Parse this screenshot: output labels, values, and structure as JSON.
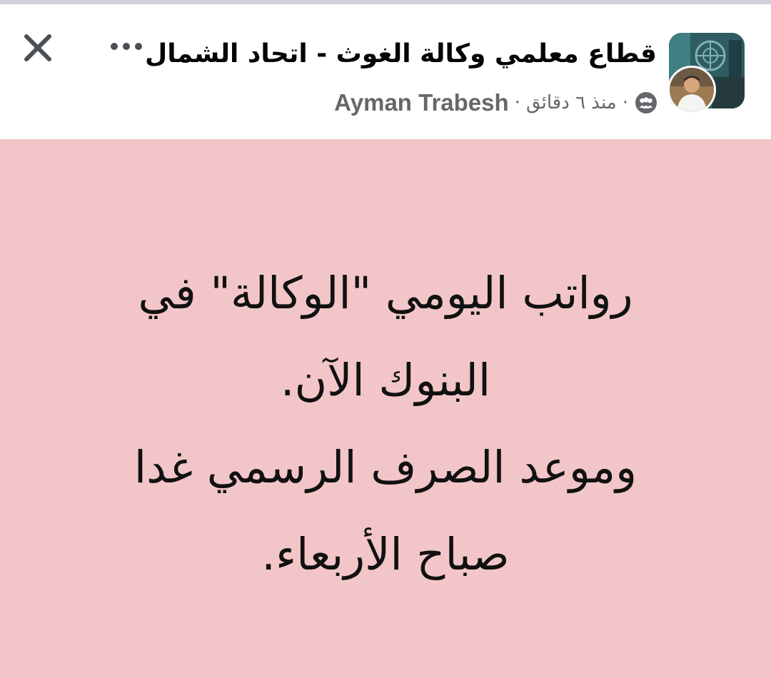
{
  "header": {
    "group_name": "قطاع معلمي وكالة الغوث - اتحاد الشمال",
    "author": "Ayman Trabesh",
    "separator": "·",
    "time_ago": "منذ ٦ دقائق",
    "privacy_icon": "group-members-icon",
    "close_icon": "close-icon",
    "more_icon": "more-horizontal-icon"
  },
  "post": {
    "background_color": "#f2c6c8",
    "lines": [
      "رواتب اليومي \"الوكالة\" في",
      "البنوك الآن.",
      "وموعد الصرف الرسمي غدا",
      "صباح الأربعاء."
    ]
  }
}
